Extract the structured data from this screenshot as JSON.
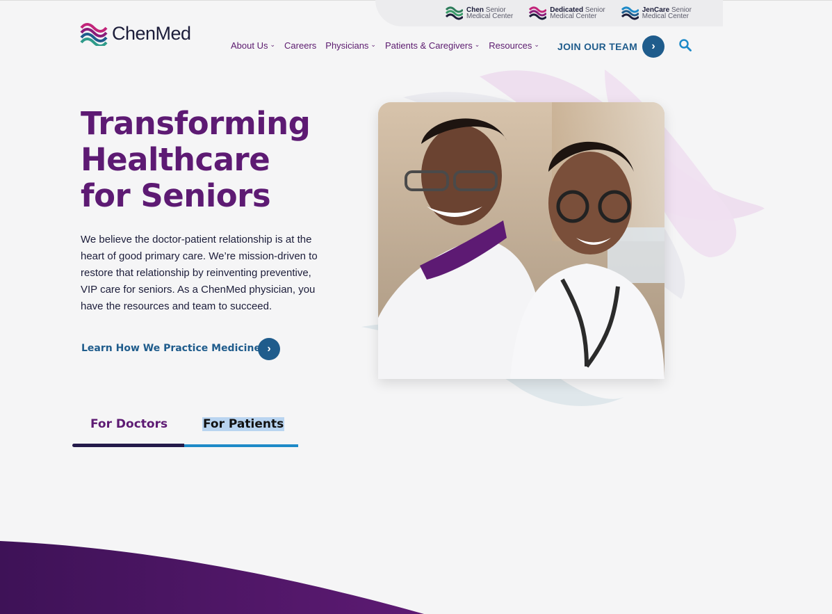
{
  "brands": [
    {
      "name": "Chen",
      "line1_rest": "Senior",
      "line2": "Medical Center",
      "color": "#2e7d5b"
    },
    {
      "name": "Dedicated",
      "line1_rest": "Senior",
      "line2": "Medical Center",
      "color": "#c2247a"
    },
    {
      "name": "JenCare",
      "line1_rest": "Senior",
      "line2": "Medical Center",
      "color": "#1f5c8c"
    }
  ],
  "logo": {
    "text": "ChenMed"
  },
  "nav": {
    "items": [
      {
        "label": "About Us",
        "dropdown": true
      },
      {
        "label": "Careers",
        "dropdown": false
      },
      {
        "label": "Physicians",
        "dropdown": true
      },
      {
        "label": "Patients & Caregivers",
        "dropdown": true
      },
      {
        "label": "Resources",
        "dropdown": true
      }
    ],
    "cta": "JOIN OUR TEAM"
  },
  "hero": {
    "headline_lines": [
      "Transforming",
      "Healthcare",
      "for Seniors"
    ],
    "body": "We believe the doctor-patient relationship is at the heart of good primary care. We’re mission-driven to restore that relationship by reinventing preventive, VIP care for seniors. As a ChenMed physician, you have the resources and team to succeed.",
    "link": "Learn How We Practice Medicine"
  },
  "tabs": [
    {
      "label": "For Doctors",
      "active": true
    },
    {
      "label": "For Patients",
      "active": false
    }
  ],
  "colors": {
    "purple": "#5d1a73",
    "blue": "#1f5c8c",
    "navy": "#1c1d3a",
    "light_blue": "#1e8ac8"
  }
}
